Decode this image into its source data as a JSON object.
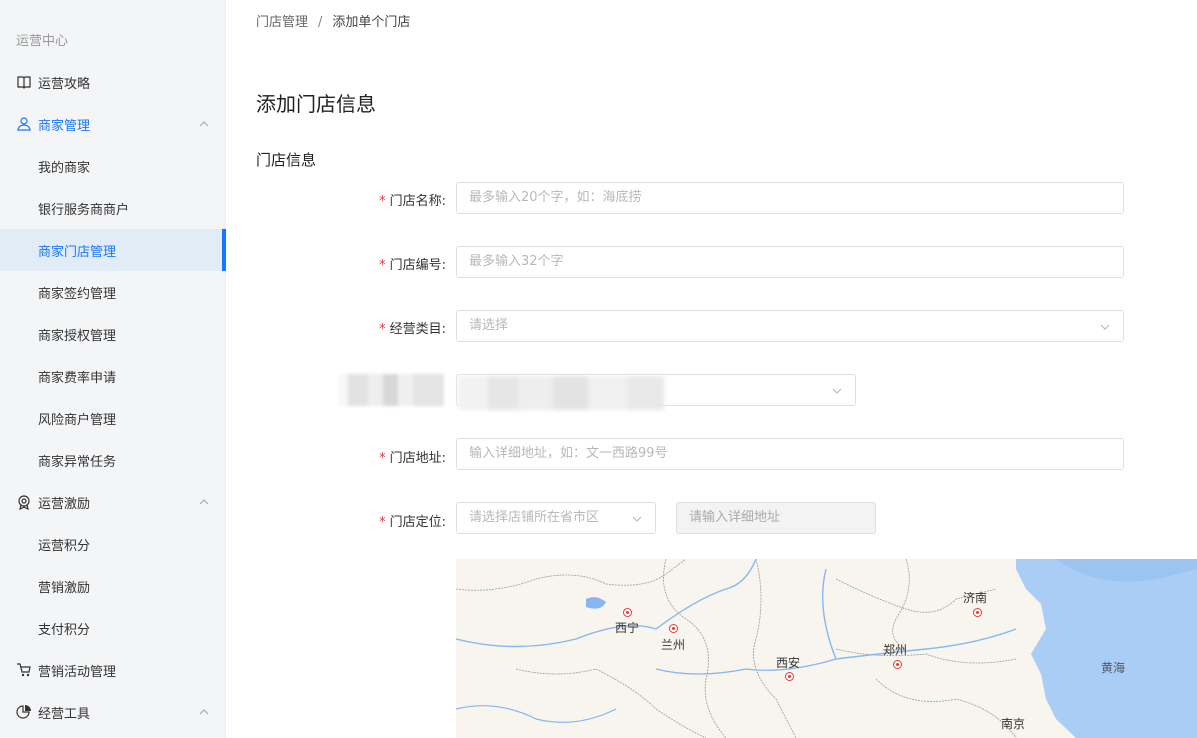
{
  "sidebar": {
    "group_title": "运营中心",
    "items": [
      {
        "label": "运营攻略"
      },
      {
        "label": "商家管理"
      },
      {
        "label": "我的商家"
      },
      {
        "label": "银行服务商商户"
      },
      {
        "label": "商家门店管理"
      },
      {
        "label": "商家签约管理"
      },
      {
        "label": "商家授权管理"
      },
      {
        "label": "商家费率申请"
      },
      {
        "label": "风险商户管理"
      },
      {
        "label": "商家异常任务"
      },
      {
        "label": "运营激励"
      },
      {
        "label": "运营积分"
      },
      {
        "label": "营销激励"
      },
      {
        "label": "支付积分"
      },
      {
        "label": "营销活动管理"
      },
      {
        "label": "经营工具"
      }
    ]
  },
  "breadcrumb": {
    "parent": "门店管理",
    "separator": "/",
    "current": "添加单个门店"
  },
  "page_title": "添加门店信息",
  "section_title": "门店信息",
  "form": {
    "required_mark": "*",
    "store_name": {
      "label": "门店名称:",
      "placeholder": "最多输入20个字，如：海底捞"
    },
    "store_code": {
      "label": "门店编号:",
      "placeholder": "最多输入32个字"
    },
    "category": {
      "label": "经营类目:",
      "placeholder": "请选择"
    },
    "address": {
      "label": "门店地址:",
      "placeholder": "输入详细地址，如：文一西路99号"
    },
    "location": {
      "label": "门店定位:",
      "region_placeholder": "请选择店铺所在省市区",
      "detail_placeholder": "请输入详细地址"
    }
  },
  "map": {
    "cities": [
      "西宁",
      "兰州",
      "西安",
      "郑州",
      "济南",
      "南京"
    ],
    "sea": "黄海"
  },
  "colors": {
    "accent": "#1677ff",
    "required": "#e53935",
    "sidebar_bg": "#f4f5f7",
    "active_bg": "#e2ecf7"
  }
}
